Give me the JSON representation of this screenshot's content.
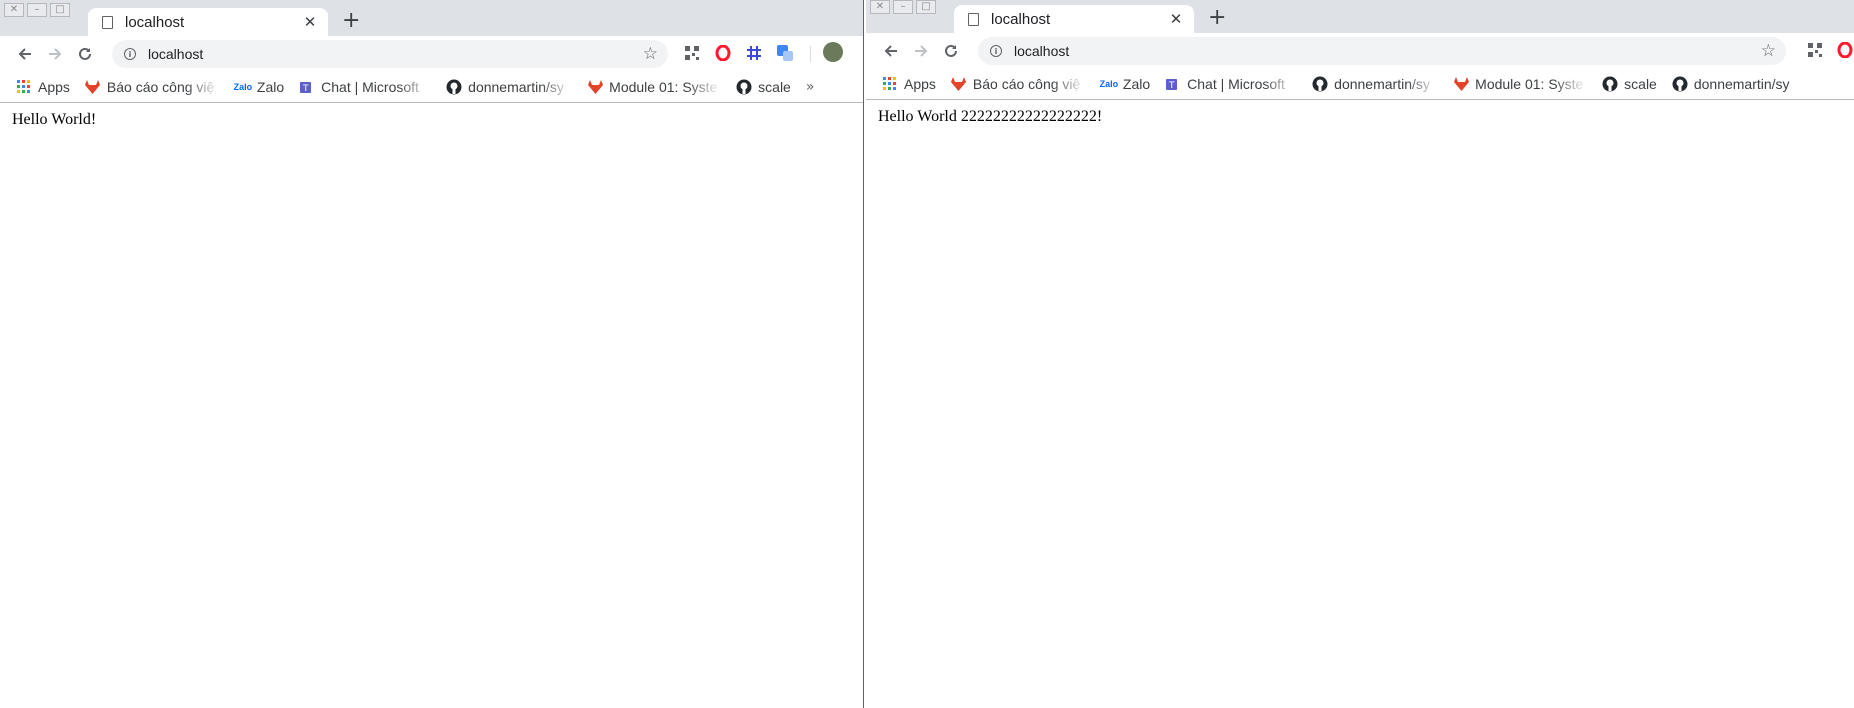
{
  "left": {
    "tab_title": "localhost",
    "url": "localhost",
    "page_text": "Hello World!"
  },
  "right": {
    "tab_title": "localhost",
    "url": "localhost",
    "page_text": "Hello World 22222222222222222!"
  },
  "bookmarks": {
    "apps": "Apps",
    "items": [
      {
        "label": "Báo cáo công việ",
        "icon": "gitlab-icon"
      },
      {
        "label": "Zalo",
        "icon": "zalo-icon"
      },
      {
        "label": "Chat | Microsoft",
        "icon": "teams-icon"
      },
      {
        "label": "donnemartin/sy",
        "icon": "github-icon"
      },
      {
        "label": "Module 01: Syste",
        "icon": "gitlab-icon"
      },
      {
        "label": "scale",
        "icon": "github-icon"
      },
      {
        "label": "donnemartin/sy",
        "icon": "github-icon"
      }
    ],
    "more": "»"
  },
  "tab_close": "✕",
  "new_tab": "+",
  "colors": {
    "gitlab": "#e24329",
    "teams": "#5b5fc7",
    "zalo": "#0068ff",
    "opera": "#ff1b2d",
    "translate": "#4285f4"
  }
}
